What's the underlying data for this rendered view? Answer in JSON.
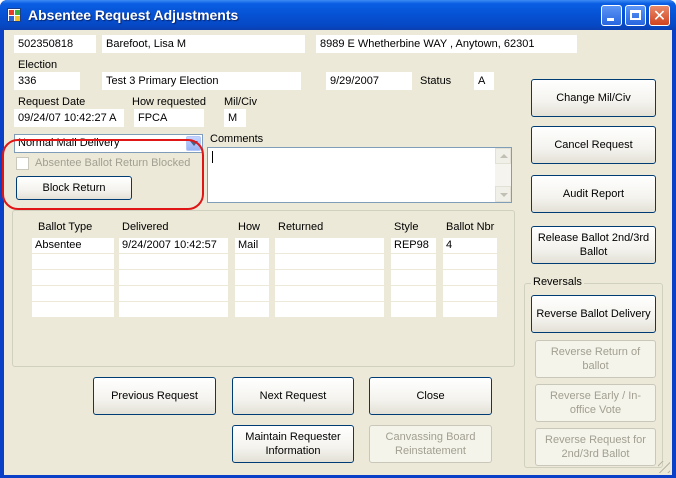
{
  "window": {
    "title": "Absentee Request Adjustments"
  },
  "voter": {
    "id": "502350818",
    "name": "Barefoot, Lisa M",
    "address": "8989 E Whetherbine WAY , Anytown, 62301"
  },
  "election": {
    "label": "Election",
    "code": "336",
    "name": "Test 3 Primary Election",
    "date": "9/29/2007",
    "status_label": "Status",
    "status": "A"
  },
  "request": {
    "date_label": "Request Date",
    "date": "09/24/07 10:42:27 A",
    "how_label": "How requested",
    "how": "FPCA",
    "milciv_label": "Mil/Civ",
    "milciv": "M"
  },
  "delivery": {
    "selected": "Normal Mail Delivery"
  },
  "comments": {
    "label": "Comments",
    "value": ""
  },
  "block": {
    "checkbox_label": "Absentee Ballot Return Blocked",
    "checked": false,
    "button": "Block Return"
  },
  "ballots": {
    "columns": [
      "Ballot Type",
      "Delivered",
      "How",
      "Returned",
      "Style",
      "Ballot Nbr"
    ],
    "rows": [
      [
        "Absentee",
        "9/24/2007 10:42:57",
        "Mail",
        "",
        "REP98",
        "4"
      ],
      [
        "",
        "",
        "",
        "",
        "",
        ""
      ],
      [
        "",
        "",
        "",
        "",
        "",
        ""
      ],
      [
        "",
        "",
        "",
        "",
        "",
        ""
      ],
      [
        "",
        "",
        "",
        "",
        "",
        ""
      ]
    ]
  },
  "actions": {
    "change_milciv": "Change Mil/Civ",
    "cancel_request": "Cancel Request",
    "audit_report": "Audit Report",
    "release_ballot": "Release Ballot 2nd/3rd Ballot"
  },
  "reversals": {
    "label": "Reversals",
    "reverse_ballot_delivery": "Reverse Ballot Delivery",
    "reverse_return": "Reverse Return of ballot",
    "reverse_early": "Reverse Early / In-office Vote",
    "reverse_request": "Reverse Request for 2nd/3rd Ballot"
  },
  "footer": {
    "previous": "Previous Request",
    "next": "Next Request",
    "close": "Close",
    "maintain": "Maintain Requester Information",
    "canvassing": "Canvassing Board Reinstatement"
  },
  "colors": {
    "titlebar": "#0653d6",
    "client_bg": "#ece9d8",
    "button_border": "#003c74",
    "highlight": "#e01616"
  }
}
